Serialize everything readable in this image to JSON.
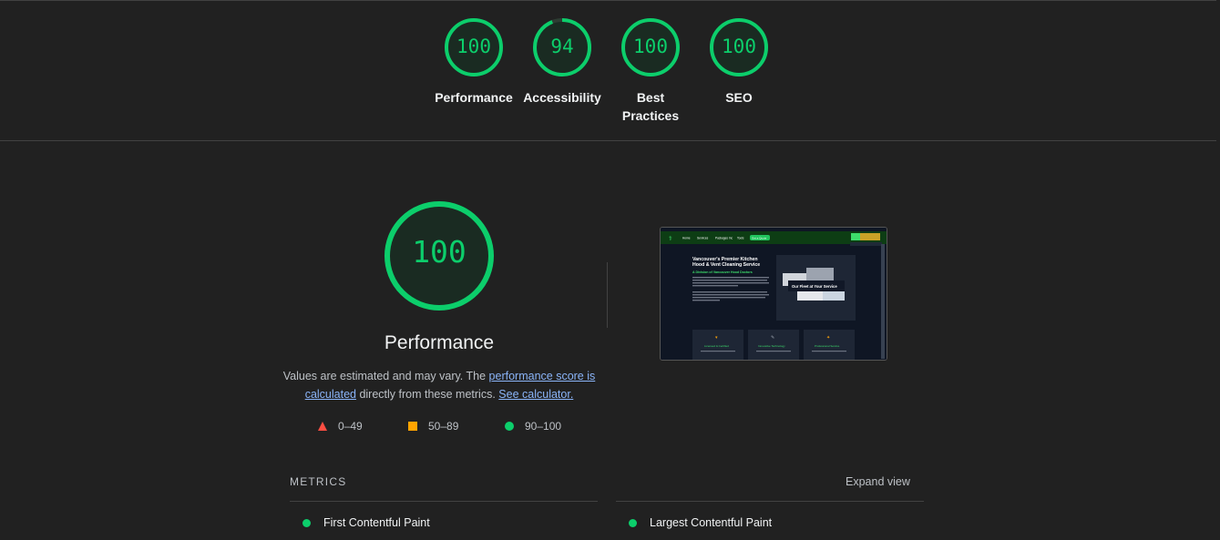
{
  "colors": {
    "pass": "#0cce6b",
    "average": "#ffa400",
    "fail": "#ff4e42"
  },
  "categories": [
    {
      "label": "Performance",
      "score": "100",
      "value": 100
    },
    {
      "label": "Accessibility",
      "score": "94",
      "value": 94
    },
    {
      "label": "Best Practices",
      "score": "100",
      "value": 100
    },
    {
      "label": "SEO",
      "score": "100",
      "value": 100
    }
  ],
  "main": {
    "score": "100",
    "title": "Performance",
    "desc_prefix": "Values are estimated and may vary. The ",
    "desc_link": "performance score is calculated",
    "desc_mid": " directly from these metrics.",
    "calc_link": "See calculator."
  },
  "legend": [
    {
      "icon": "triangle-icon",
      "label": "0–49"
    },
    {
      "icon": "square-icon",
      "label": "50–89"
    },
    {
      "icon": "circle-icon",
      "label": "90–100"
    }
  ],
  "screenshot": {
    "nav": [
      "Home",
      "Services",
      "Packages Inc",
      "Tools",
      "Get a Quote"
    ],
    "heading": "Vancouver's Premier Kitchen Hood & Vent Cleaning Service",
    "subheading": "A Division of Vancouver Hood Doctors",
    "fleet_caption": "Our Fleet at Your Service",
    "cards": [
      "Licensed & Certified",
      "Innovative Technology",
      "Professional Service"
    ]
  },
  "metrics": {
    "header": "METRICS",
    "expand": "Expand view",
    "items": [
      "First Contentful Paint",
      "Largest Contentful Paint"
    ]
  }
}
